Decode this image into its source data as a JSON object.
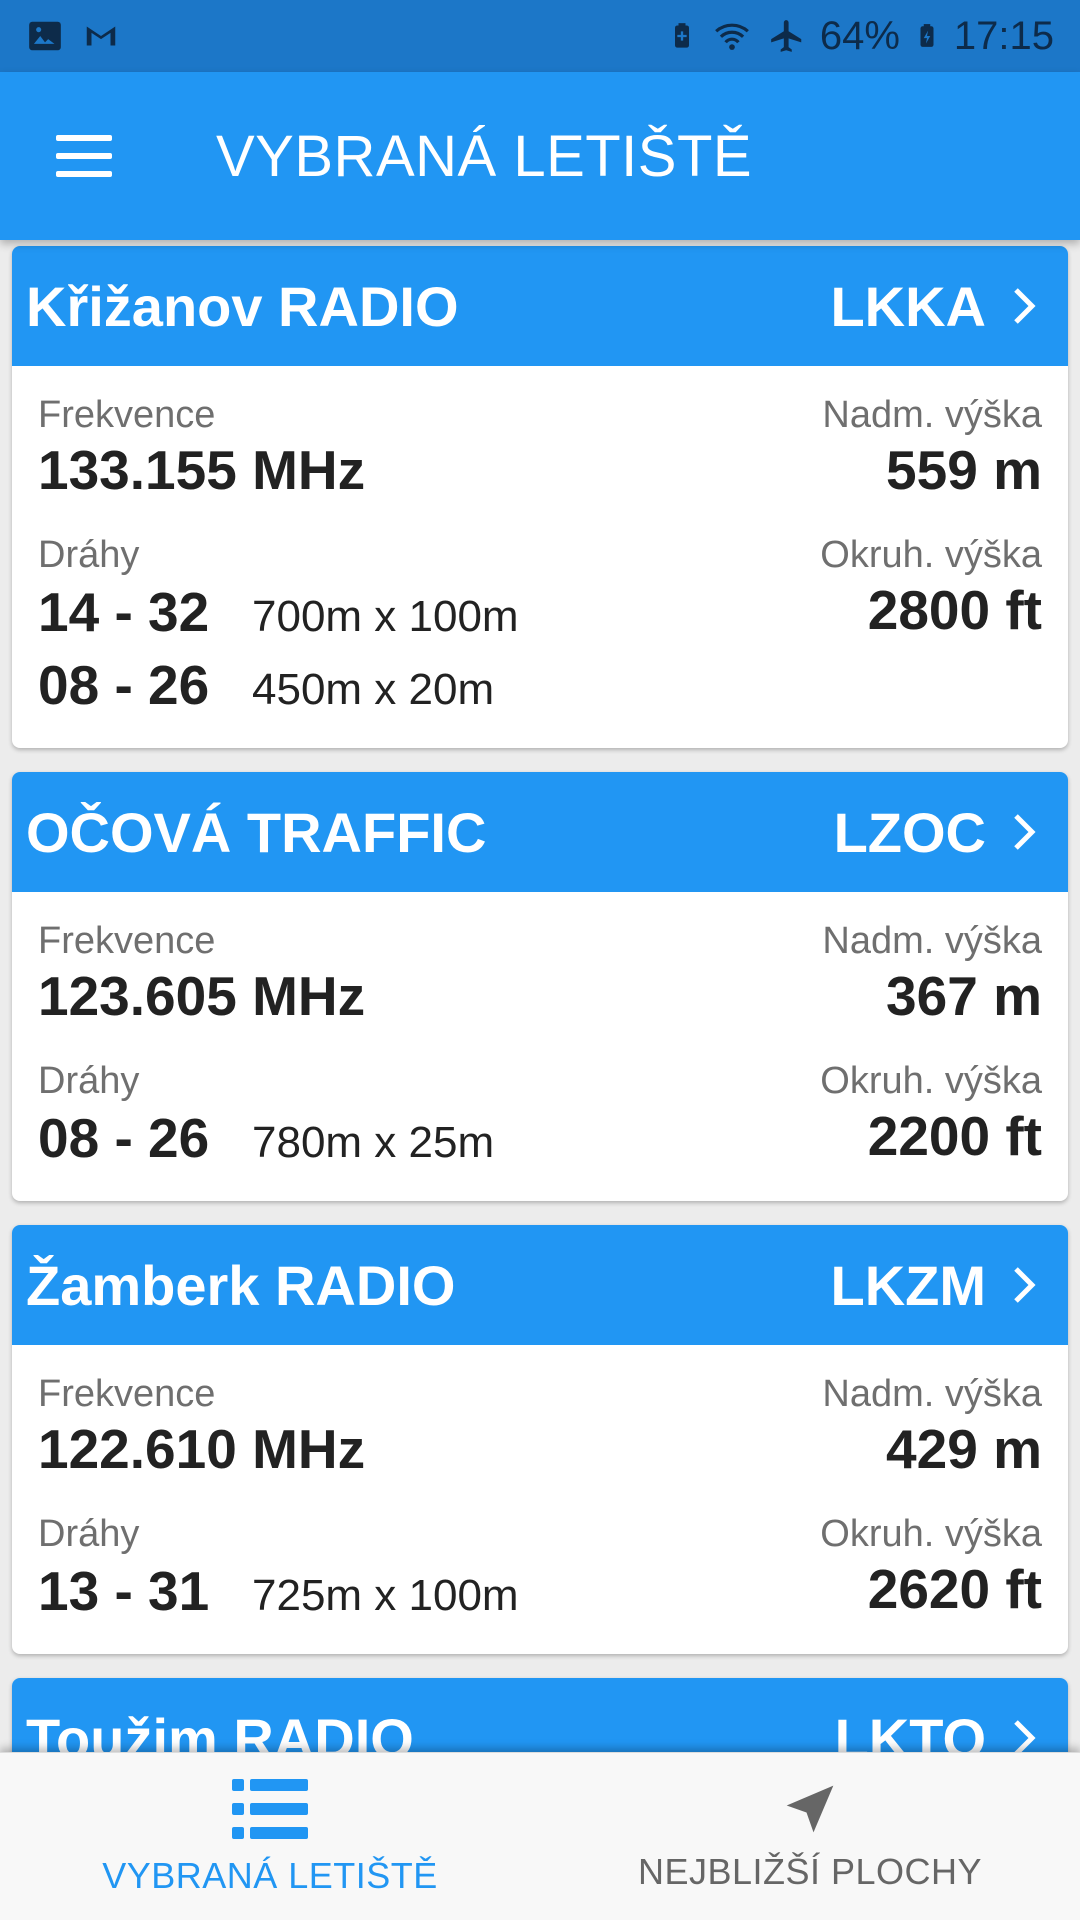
{
  "status_bar": {
    "battery": "64%",
    "time": "17:15",
    "icons": [
      "image-icon",
      "gmail-icon",
      "battery-saver-icon",
      "wifi-icon",
      "airplane-icon",
      "battery-icon"
    ]
  },
  "app_bar": {
    "title": "VYBRANÁ LETIŠTĚ"
  },
  "airports": [
    {
      "name": "Křižanov RADIO",
      "code": "LKKA",
      "freq_label": "Frekvence",
      "frequency": "133.155 MHz",
      "elev_label": "Nadm. výška",
      "elevation": "559 m",
      "runways_label": "Dráhy",
      "runways": [
        {
          "id": "14 - 32",
          "dims": "700m x 100m"
        },
        {
          "id": "08 - 26",
          "dims": "450m x 20m"
        }
      ],
      "circuit_label": "Okruh. výška",
      "circuit": "2800 ft"
    },
    {
      "name": "OČOVÁ TRAFFIC",
      "code": "LZOC",
      "freq_label": "Frekvence",
      "frequency": "123.605 MHz",
      "elev_label": "Nadm. výška",
      "elevation": "367 m",
      "runways_label": "Dráhy",
      "runways": [
        {
          "id": "08 - 26",
          "dims": "780m x 25m"
        }
      ],
      "circuit_label": "Okruh. výška",
      "circuit": "2200 ft"
    },
    {
      "name": "Žamberk RADIO",
      "code": "LKZM",
      "freq_label": "Frekvence",
      "frequency": "122.610 MHz",
      "elev_label": "Nadm. výška",
      "elevation": "429 m",
      "runways_label": "Dráhy",
      "runways": [
        {
          "id": "13 - 31",
          "dims": "725m x 100m"
        }
      ],
      "circuit_label": "Okruh. výška",
      "circuit": "2620 ft"
    },
    {
      "name": "Toužim RADIO",
      "code": "LKTO"
    }
  ],
  "bottom_nav": {
    "items": [
      {
        "label": "VYBRANÁ LETIŠTĚ",
        "icon": "list-icon",
        "active": true
      },
      {
        "label": "NEJBLIŽŠÍ PLOCHY",
        "icon": "navigation-arrow-icon",
        "active": false
      }
    ]
  },
  "colors": {
    "primary": "#2196f3",
    "status_bar": "#1c77c8",
    "text_dark": "#222222",
    "label_grey": "#6f6f6f"
  }
}
